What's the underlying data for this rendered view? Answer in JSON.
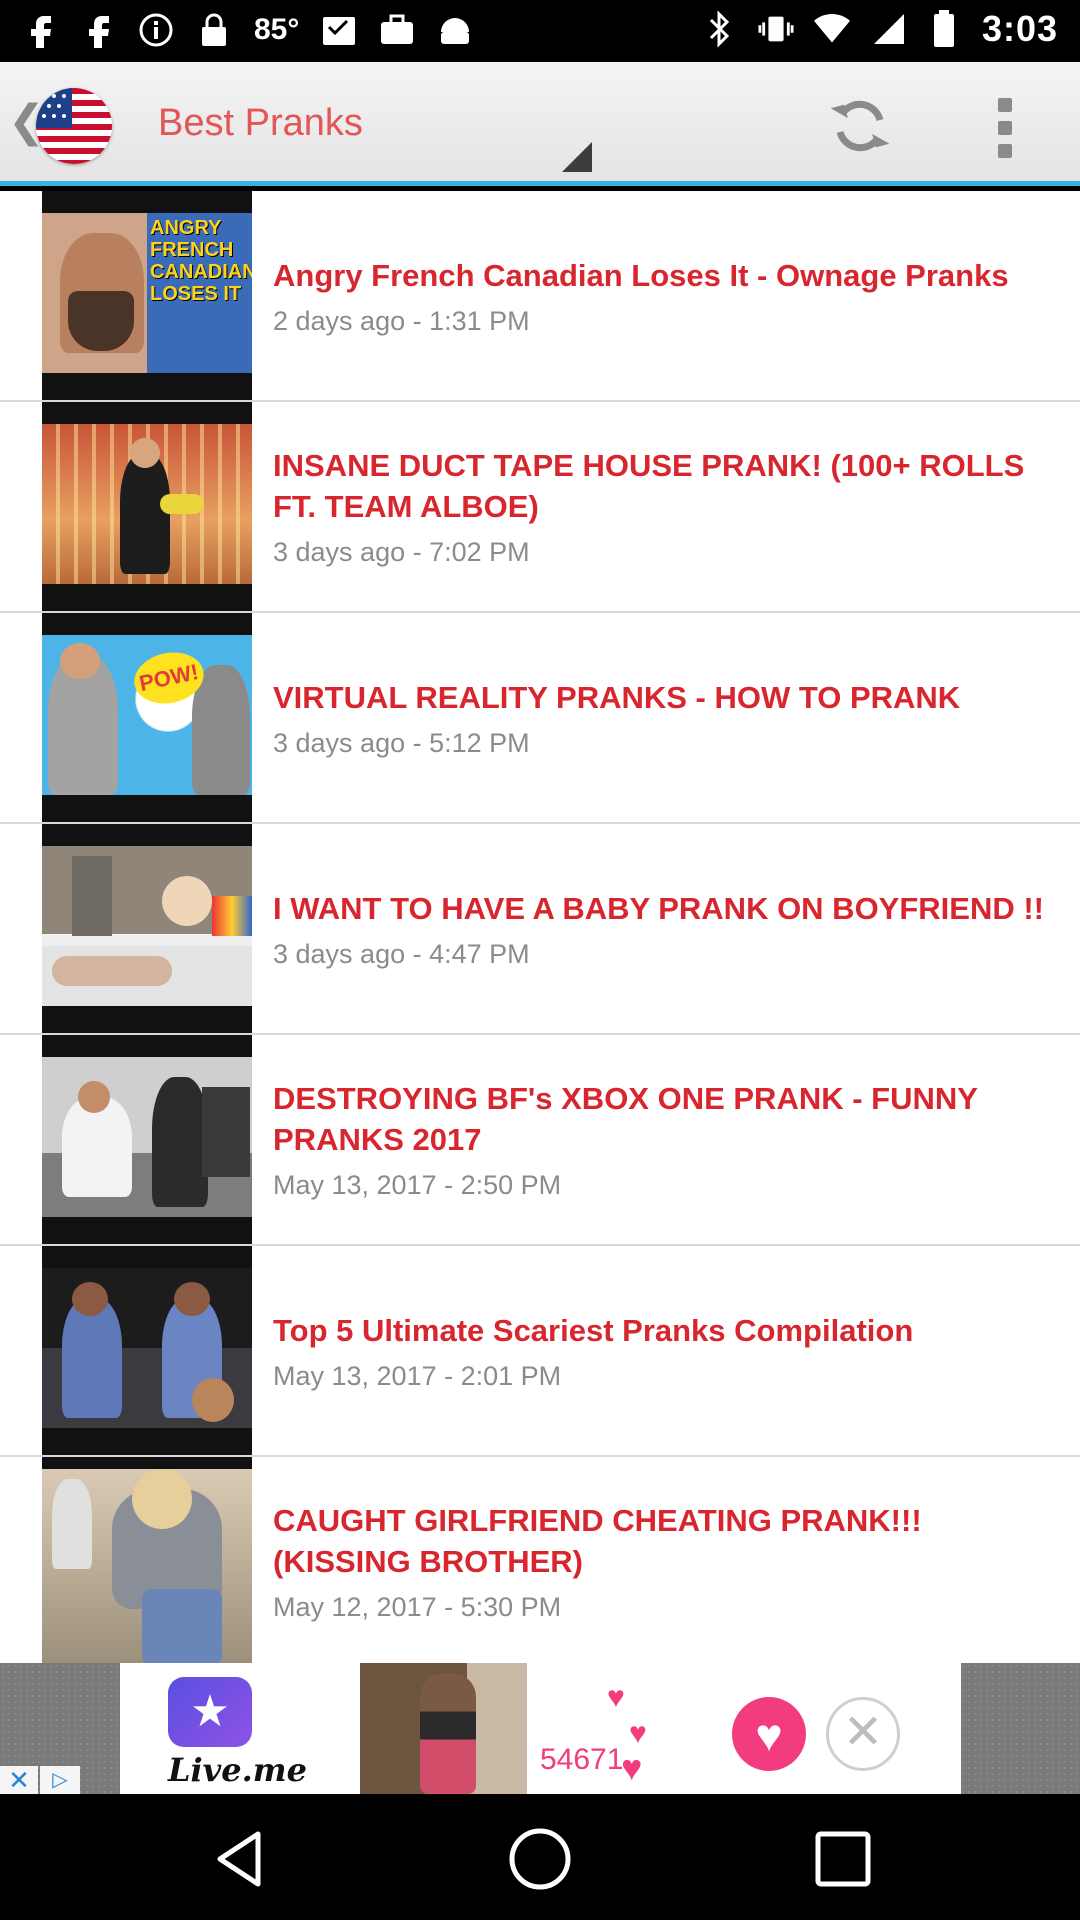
{
  "status_bar": {
    "temperature": "85°",
    "time": "3:03",
    "left_icons": [
      "facebook-icon",
      "facebook-icon",
      "info-icon",
      "lock-icon",
      "temperature",
      "inbox-icon",
      "briefcase-icon",
      "android-icon"
    ],
    "right_icons": [
      "bluetooth-icon",
      "vibrate-icon",
      "wifi-icon",
      "signal-icon",
      "battery-icon"
    ]
  },
  "app_bar": {
    "title": "Best Pranks",
    "icons": [
      "back-chevron-icon",
      "us-flag-icon",
      "dropdown-triangle-icon",
      "refresh-icon",
      "more-vert-icon"
    ]
  },
  "videos": [
    {
      "title": "Angry French Canadian Loses It - Ownage Pranks",
      "date": "2 days ago - 1:31 PM",
      "thumbnail_text": "ANGRY FRENCH CANADIAN LOSES IT"
    },
    {
      "title": "INSANE DUCT TAPE HOUSE PRANK! (100+ ROLLS FT. TEAM ALBOE)",
      "date": "3 days ago - 7:02 PM"
    },
    {
      "title": "VIRTUAL REALITY PRANKS - HOW TO PRANK",
      "date": "3 days ago - 5:12 PM",
      "thumbnail_text": "POW!"
    },
    {
      "title": "I WANT TO HAVE A BABY PRANK ON BOYFRIEND !!",
      "date": "3 days ago - 4:47 PM"
    },
    {
      "title": "DESTROYING BF's XBOX ONE PRANK - FUNNY PRANKS 2017",
      "date": "May 13, 2017 - 2:50 PM"
    },
    {
      "title": "Top 5 Ultimate Scariest Pranks Compilation",
      "date": "May 13, 2017 - 2:01 PM"
    },
    {
      "title": "CAUGHT GIRLFRIEND CHEATING PRANK!!! (KISSING BROTHER)",
      "date": "May 12, 2017 - 5:30 PM"
    }
  ],
  "ad": {
    "logo_text": "Live.me",
    "count": "54671",
    "icons": [
      "star-icon",
      "heart-icon",
      "close-circle-icon",
      "ad-close-icon",
      "ad-choices-icon"
    ]
  },
  "nav_bar": {
    "icons": [
      "back-triangle-icon",
      "home-circle-icon",
      "recents-square-icon"
    ]
  },
  "colors": {
    "accent_blue": "#35b3e3",
    "title_red": "#d8262f",
    "app_title_red": "#e25656",
    "date_gray": "#8b8b8b",
    "ad_pink": "#f33b7f"
  }
}
